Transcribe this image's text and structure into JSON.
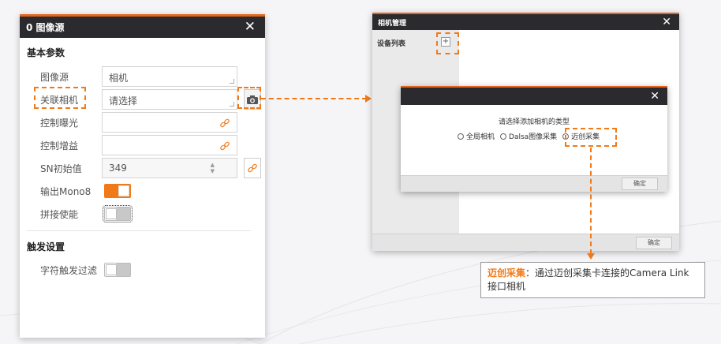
{
  "left_panel": {
    "title": "0 图像源",
    "section_basic": "基本参数",
    "rows": [
      {
        "label": "图像源",
        "value": "相机"
      },
      {
        "label": "关联相机",
        "value": "请选择"
      },
      {
        "label": "控制曝光",
        "value": ""
      },
      {
        "label": "控制增益",
        "value": ""
      },
      {
        "label": "SN初始值",
        "value": "349"
      },
      {
        "label": "输出Mono8",
        "state": "on"
      },
      {
        "label": "拼接使能",
        "state": "off"
      }
    ],
    "section_trigger": "触发设置",
    "trigger_rows": [
      {
        "label": "字符触发过滤",
        "state": "off"
      }
    ]
  },
  "camera_manager": {
    "title": "相机管理",
    "device_list_label": "设备列表",
    "add_label": "+",
    "ok_label": "确定"
  },
  "add_camera_dialog": {
    "prompt": "请选择添加相机的类型",
    "options": [
      "全局相机",
      "Dalsa图像采集",
      "迈创采集"
    ],
    "ok_label": "确定"
  },
  "annotation": {
    "highlight": "迈创采集",
    "text": "：通过迈创采集卡连接的Camera Link接口相机"
  },
  "colors": {
    "accent": "#f07a1a",
    "titlebar": "#2b2b2f"
  },
  "icons": {
    "close": "close-icon",
    "camera": "camera-icon",
    "link": "link-icon"
  }
}
